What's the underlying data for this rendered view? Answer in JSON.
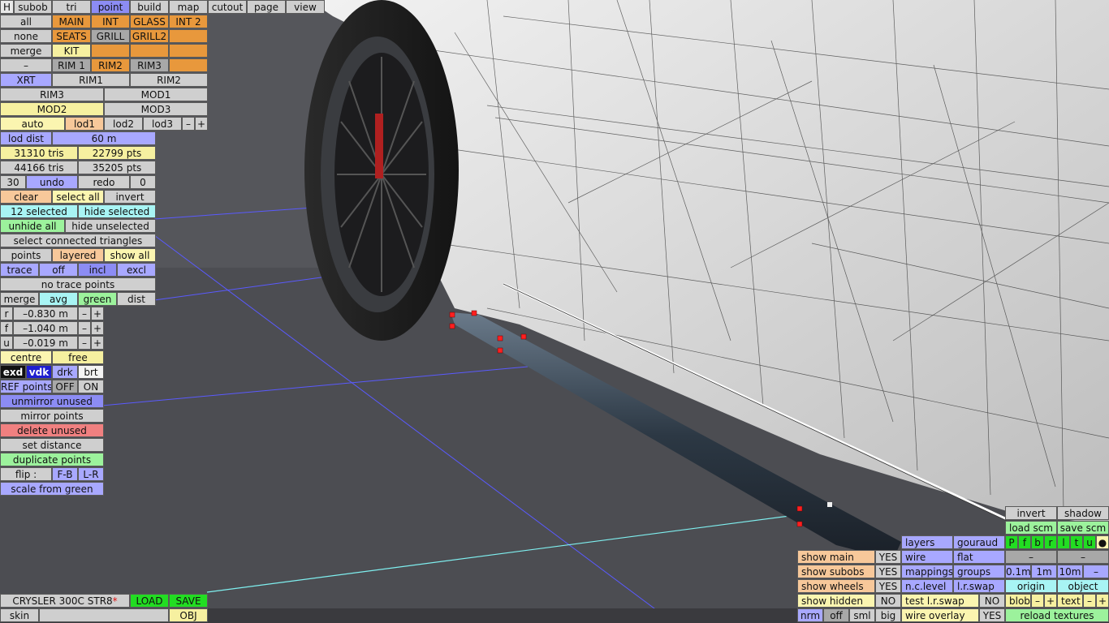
{
  "top_tabs": [
    "H",
    "subob",
    "tri",
    "point",
    "build",
    "map",
    "cutout",
    "page",
    "view"
  ],
  "parts_row1": [
    "all",
    "MAIN",
    "INT",
    "GLASS",
    "INT 2"
  ],
  "parts_row2": [
    "none",
    "SEATS",
    "GRILL",
    "GRILL2",
    ""
  ],
  "parts_row3": [
    "merge",
    "KIT",
    "",
    "",
    ""
  ],
  "parts_row4": [
    "–",
    "RIM 1",
    "RIM2",
    "RIM3",
    ""
  ],
  "row_xrt": [
    "XRT",
    "RIM1",
    "RIM2"
  ],
  "row_rim3": [
    "RIM3",
    "MOD1"
  ],
  "row_mod2": [
    "MOD2",
    "MOD3"
  ],
  "lod": {
    "auto": "auto",
    "lod1": "lod1",
    "lod2": "lod2",
    "lod3": "lod3",
    "minus": "–",
    "plus": "+"
  },
  "lod_dist": {
    "label": "lod dist",
    "value": "60 m"
  },
  "stats": {
    "tris1": "31310 tris",
    "pts1": "22799 pts",
    "tris2": "44166 tris",
    "pts2": "35205 pts"
  },
  "undo_row": {
    "left": "30",
    "undo": "undo",
    "redo": "redo",
    "right": "0"
  },
  "select_row": {
    "clear": "clear",
    "select_all": "select all",
    "invert": "invert"
  },
  "selected_row": {
    "count": "12 selected",
    "hide": "hide selected"
  },
  "unhide_row": {
    "unhide": "unhide all",
    "hide_unsel": "hide unselected"
  },
  "connected": "select connected triangles",
  "points_row": {
    "points": "points",
    "layered": "layered",
    "show_all": "show all"
  },
  "trace_row": {
    "trace": "trace",
    "off": "off",
    "incl": "incl",
    "excl": "excl"
  },
  "no_trace": "no trace points",
  "merge_row": {
    "merge": "merge",
    "avg": "avg",
    "green": "green",
    "dist": "dist"
  },
  "coords": [
    {
      "axis": "r",
      "value": "–0.830 m"
    },
    {
      "axis": "f",
      "value": "–1.040 m"
    },
    {
      "axis": "u",
      "value": "–0.019 m"
    }
  ],
  "coord_minus": "–",
  "coord_plus": "+",
  "centre_row": {
    "centre": "centre",
    "free": "free"
  },
  "mode_row": {
    "exd": "exd",
    "vdk": "vdk",
    "drk": "drk",
    "brt": "brt"
  },
  "ref_row": {
    "ref": "REF points",
    "off": "OFF",
    "on": "ON"
  },
  "unmirror": "unmirror unused",
  "mirror": "mirror points",
  "delete_unused": "delete unused",
  "set_distance": "set distance",
  "duplicate": "duplicate points",
  "flip_row": {
    "flip": "flip :",
    "fb": "F-B",
    "lr": "L-R"
  },
  "scale": "scale from green",
  "model": {
    "name": "CRYSLER 300C STR8",
    "marker": "*",
    "load": "LOAD",
    "save": "SAVE",
    "skin": "skin",
    "obj": "OBJ"
  },
  "right_panel": {
    "invert": "invert",
    "shadow": "shadow",
    "load_scm": "load scm",
    "save_scm": "save scm",
    "toggles": [
      "P",
      "f",
      "b",
      "r",
      "l",
      "t",
      "u",
      "●"
    ],
    "dash": "–",
    "show_main": "show main",
    "show_main_val": "YES",
    "show_subobs": "show subobs",
    "show_subobs_val": "YES",
    "show_wheels": "show wheels",
    "show_wheels_val": "YES",
    "show_hidden": "show hidden",
    "show_hidden_val": "NO",
    "nrm": "nrm",
    "off": "off",
    "sml": "sml",
    "big": "big",
    "layers": "layers",
    "gouraud": "gouraud",
    "wire": "wire",
    "flat": "flat",
    "mappings": "mappings",
    "groups": "groups",
    "nclevel": "n.c.level",
    "lrswap": "l.r.swap",
    "test_lrswap": "test l.r.swap",
    "test_val": "NO",
    "wire_overlay": "wire overlay",
    "wire_val": "YES",
    "d01": "0.1m",
    "d1": "1m",
    "d10": "10m",
    "dminus": "–",
    "origin": "origin",
    "object": "object",
    "blob": "blob",
    "text": "text",
    "minus": "–",
    "plus": "+",
    "reload": "reload textures"
  }
}
